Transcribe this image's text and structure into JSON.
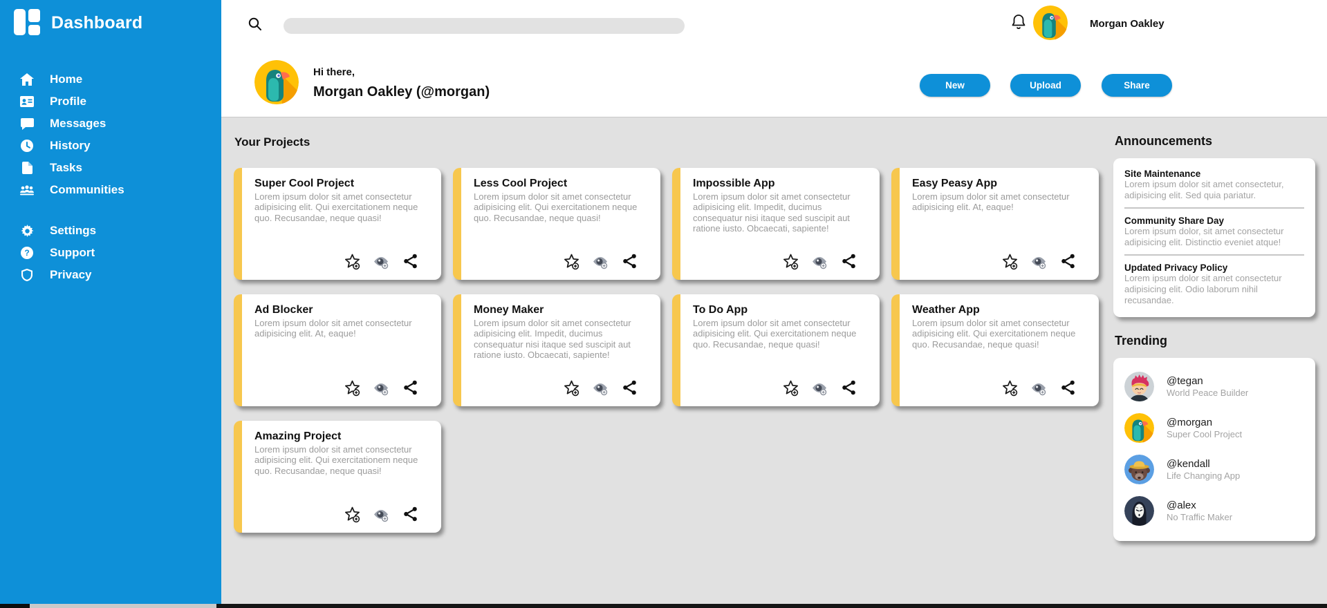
{
  "colors": {
    "accent_blue": "#0e90d8",
    "card_yellow": "#f7c74e",
    "background_gray": "#e1e1e1",
    "muted_text": "#9b9b9b"
  },
  "sidebar": {
    "title": "Dashboard",
    "main_items": [
      {
        "label": "Home",
        "icon": "home-icon"
      },
      {
        "label": "Profile",
        "icon": "profile-icon"
      },
      {
        "label": "Messages",
        "icon": "messages-icon"
      },
      {
        "label": "History",
        "icon": "history-icon"
      },
      {
        "label": "Tasks",
        "icon": "tasks-icon"
      },
      {
        "label": "Communities",
        "icon": "communities-icon"
      }
    ],
    "secondary_items": [
      {
        "label": "Settings",
        "icon": "settings-icon"
      },
      {
        "label": "Support",
        "icon": "support-icon"
      },
      {
        "label": "Privacy",
        "icon": "privacy-icon"
      }
    ]
  },
  "topbar": {
    "search_placeholder": "",
    "search_value": "",
    "user_name": "Morgan Oakley"
  },
  "header": {
    "greeting": "Hi there,",
    "user_line": "Morgan Oakley (@morgan)",
    "buttons": [
      {
        "label": "New"
      },
      {
        "label": "Upload"
      },
      {
        "label": "Share"
      }
    ]
  },
  "projects": {
    "heading": "Your Projects",
    "cards": [
      {
        "title": "Super Cool Project",
        "description": "Lorem ipsum dolor sit amet consectetur adipisicing elit. Qui exercitationem neque quo. Recusandae, neque quasi!"
      },
      {
        "title": "Less Cool Project",
        "description": "Lorem ipsum dolor sit amet consectetur adipisicing elit. Qui exercitationem neque quo. Recusandae, neque quasi!"
      },
      {
        "title": "Impossible App",
        "description": "Lorem ipsum dolor sit amet consectetur adipisicing elit. Impedit, ducimus consequatur nisi itaque sed suscipit aut ratione iusto. Obcaecati, sapiente!"
      },
      {
        "title": "Easy Peasy App",
        "description": "Lorem ipsum dolor sit amet consectetur adipisicing elit. At, eaque!"
      },
      {
        "title": "Ad Blocker",
        "description": "Lorem ipsum dolor sit amet consectetur adipisicing elit. At, eaque!"
      },
      {
        "title": "Money Maker",
        "description": "Lorem ipsum dolor sit amet consectetur adipisicing elit. Impedit, ducimus consequatur nisi itaque sed suscipit aut ratione iusto. Obcaecati, sapiente!"
      },
      {
        "title": "To Do App",
        "description": "Lorem ipsum dolor sit amet consectetur adipisicing elit. Qui exercitationem neque quo. Recusandae, neque quasi!"
      },
      {
        "title": "Weather App",
        "description": "Lorem ipsum dolor sit amet consectetur adipisicing elit. Qui exercitationem neque quo. Recusandae, neque quasi!"
      },
      {
        "title": "Amazing Project",
        "description": "Lorem ipsum dolor sit amet consectetur adipisicing elit. Qui exercitationem neque quo. Recusandae, neque quasi!"
      }
    ],
    "card_actions": [
      "favorite-add",
      "watch-add",
      "share"
    ]
  },
  "announcements": {
    "heading": "Announcements",
    "items": [
      {
        "title": "Site Maintenance",
        "body": "Lorem ipsum dolor sit amet consectetur, adipisicing elit. Sed quia pariatur."
      },
      {
        "title": "Community Share Day",
        "body": "Lorem ipsum dolor, sit amet consectetur adipisicing elit. Distinctio eveniet atque!"
      },
      {
        "title": "Updated Privacy Policy",
        "body": "Lorem ipsum dolor sit amet consectetur adipisicing elit. Odio laborum nihil recusandae."
      }
    ]
  },
  "trending": {
    "heading": "Trending",
    "items": [
      {
        "handle": "@tegan",
        "subtitle": "World Peace Builder",
        "avatar": "avatar-tegan"
      },
      {
        "handle": "@morgan",
        "subtitle": "Super Cool Project",
        "avatar": "avatar-morgan"
      },
      {
        "handle": "@kendall",
        "subtitle": "Life Changing App",
        "avatar": "avatar-kendall"
      },
      {
        "handle": "@alex",
        "subtitle": "No Traffic Maker",
        "avatar": "avatar-alex"
      }
    ]
  }
}
